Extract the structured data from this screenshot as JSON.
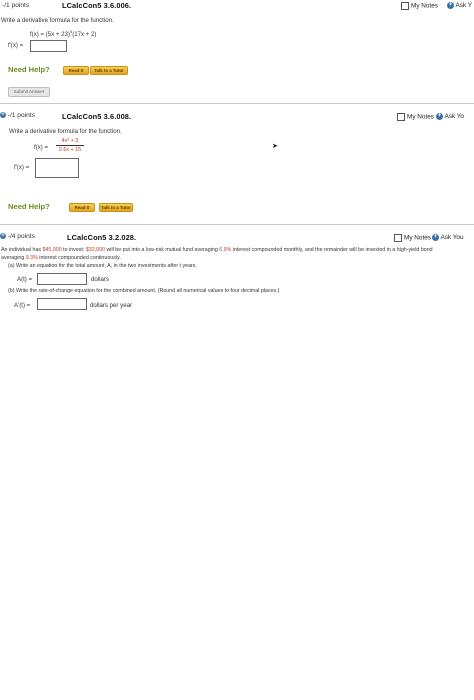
{
  "problem1": {
    "points": "-/1 points",
    "id": "LCalcCon5 3.6.006.",
    "my_notes": "My Notes",
    "ask": "Ask Y",
    "prompt": "Write a derivative formula for the function.",
    "function": "f(x) = (5x + 23)",
    "function_exp": "5",
    "function_tail": "(17x + 2)",
    "fprime_label": "f'(x) ="
  },
  "help1": {
    "label": "Need Help?",
    "read": "Read It",
    "talk": "Talk to a Tutor"
  },
  "submit": {
    "label": "Submit Answer"
  },
  "problem2": {
    "points": "-/1 points",
    "id": "LCalcCon5 3.6.008.",
    "my_notes": "My Notes",
    "ask": "Ask Yo",
    "prompt": "Write a derivative formula for the function.",
    "f_label": "f(x) =",
    "numerator": "4x³ + 3",
    "denominator": "2.6x + 15",
    "fprime_label": "f'(x) ="
  },
  "help2": {
    "label": "Need Help?",
    "read": "Read It",
    "talk": "Talk to a Tutor"
  },
  "problem3": {
    "points": "-/4 points",
    "id": "LCalcCon5 3.2.028.",
    "my_notes": "My Notes",
    "ask": "Ask You",
    "line1_a": "An individual has ",
    "line1_b": "$45,000",
    "line1_c": " to invest: ",
    "line1_d": "$32,000",
    "line1_e": " will be put into a low-risk mutual fund averaging ",
    "line1_f": "6.9%",
    "line1_g": " interest compounded monthly, and the remainder will be invested in a high-yield bond",
    "line2_a": "averaging ",
    "line2_b": "9.3%",
    "line2_c": " interest compounded continuously.",
    "part_a": "(a) Write an equation for the total amount, A, in the two investments after t years.",
    "a_label": "A(t) =",
    "a_unit": "dollars",
    "part_b": "(b) Write the rate-of-change equation for the combined amount. (Round all numerical values to four decimal places.)",
    "b_label": "A'(t) =",
    "b_unit": "dollars per year"
  }
}
